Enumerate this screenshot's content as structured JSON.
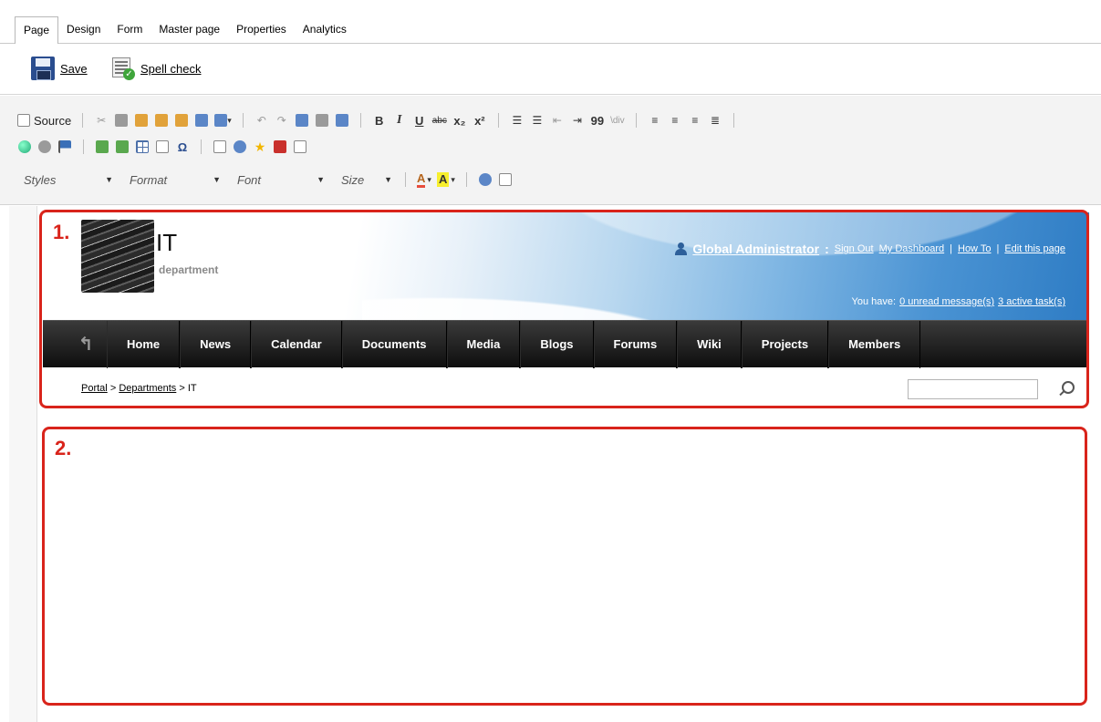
{
  "tabs": [
    "Page",
    "Design",
    "Form",
    "Master page",
    "Properties",
    "Analytics"
  ],
  "actions": {
    "save": "Save",
    "spellcheck": "Spell check"
  },
  "editor": {
    "source": "Source",
    "format_buttons": {
      "bold": "B",
      "italic": "I",
      "underline": "U",
      "strike": "abc",
      "subscript": "x₂",
      "superscript": "x²",
      "quote": "99",
      "div": "\\div"
    },
    "combos": {
      "styles": "Styles",
      "format": "Format",
      "font": "Font",
      "size": "Size"
    },
    "text_color": "A",
    "bg_color": "A",
    "omega": "Ω"
  },
  "site": {
    "title": "IT",
    "subtitle": "department",
    "user": "Global Administrator",
    "user_colon": ":",
    "links": [
      "Sign Out",
      "My Dashboard",
      "How To",
      "Edit this page"
    ],
    "messages_prefix": "You have:",
    "unread": "0 unread message(s)",
    "tasks": "3 active task(s)",
    "nav": [
      "Home",
      "News",
      "Calendar",
      "Documents",
      "Media",
      "Blogs",
      "Forums",
      "Wiki",
      "Projects",
      "Members"
    ],
    "breadcrumb": {
      "portal": "Portal",
      "sep1": ">",
      "departments": "Departments",
      "sep2": ">",
      "current": "IT"
    },
    "search_placeholder": ""
  },
  "regions": [
    "1.",
    "2."
  ],
  "colors": {
    "region_border": "#d9241b",
    "nav_bg": "#111111",
    "header_blue": "#2e7cc4"
  }
}
